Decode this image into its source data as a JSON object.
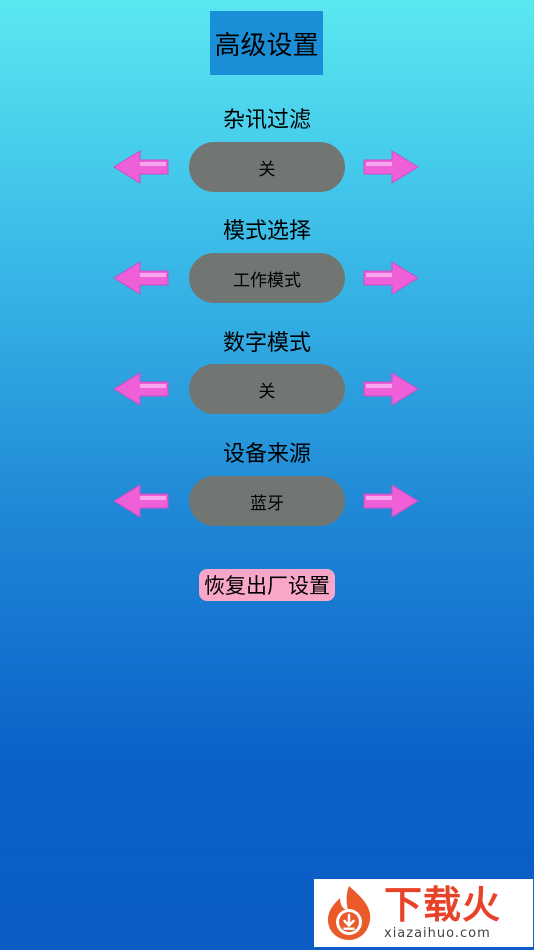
{
  "title": "高级设置",
  "settings": [
    {
      "label": "杂讯过滤",
      "value": "关"
    },
    {
      "label": "模式选择",
      "value": "工作模式"
    },
    {
      "label": "数字模式",
      "value": "关"
    },
    {
      "label": "设备来源",
      "value": "蓝牙"
    }
  ],
  "reset_label": "恢复出厂设置",
  "watermark": {
    "brand": "下载火",
    "url": "xiazaihuo.com"
  },
  "colors": {
    "arrow": "#ee5fd8",
    "pill": "#717673",
    "title_bg": "#1a8fd8",
    "reset_bg": "#f9a7c8",
    "brand": "#e8432a"
  },
  "icons": {
    "prev": "left-arrow-icon",
    "next": "right-arrow-icon",
    "logo": "flame-logo-icon"
  }
}
